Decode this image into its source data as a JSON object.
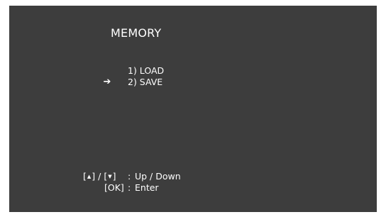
{
  "screen": {
    "title": "MEMORY",
    "colors": {
      "background": "#3d3d3d",
      "text": "#ffffff"
    }
  },
  "menu": {
    "selected_index": 1,
    "cursor_icon": "right-arrow-icon",
    "items": [
      {
        "label": "1) LOAD",
        "selected": false
      },
      {
        "label": "2) SAVE",
        "selected": true
      }
    ]
  },
  "help": {
    "nav_key_left_open": "[",
    "nav_key_left_icon": "up-triangle-icon",
    "nav_key_left_close": "]",
    "nav_key_slash": "/",
    "nav_key_right_open": "[",
    "nav_key_right_icon": "down-triangle-icon",
    "nav_key_right_close": "]",
    "nav_colon": ":",
    "nav_desc": "Up / Down",
    "ok_key": "[OK]",
    "ok_colon": ":",
    "ok_desc": "Enter"
  }
}
